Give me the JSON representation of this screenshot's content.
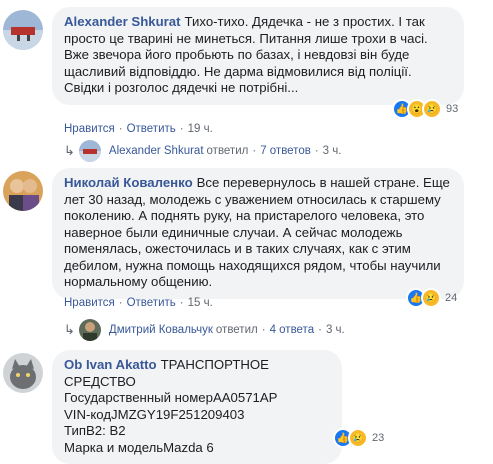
{
  "comments": [
    {
      "author": "Alexander Shkurat",
      "text": "Тихо-тихо. Дядечка - не з простих. І так просто це тварині не минеться. Питання лише трохи в часі. Вже звечора його пробьють по базах, і невдовзі він буде щасливий відповіддю. Не дарма відмовилися від поліції. Свідки і розголос дядечкі не потрібні...",
      "like_label": "Нравится",
      "reply_label": "Ответить",
      "time": "19 ч.",
      "reaction_count": "93",
      "reactions": [
        "like-icon",
        "wow-icon",
        "sad-icon"
      ],
      "replies": {
        "author": "Alexander Shkurat",
        "replied": "ответил",
        "count": "7 ответов",
        "time": "3 ч."
      }
    },
    {
      "author": "Николай Коваленко",
      "text": "Все перевернулось в нашей стране. Еще лет 30 назад, молодежь с уважением относилась к старшему поколению. А поднять руку, на пристарелого человека, это наверное были единичные случаи. А сейчас молодежь поменялась, ожесточилась и в таких случаях, как с этим дебилом, нужна помощь находящихся рядом, чтобы научили нормальному общению.",
      "like_label": "Нравится",
      "reply_label": "Ответить",
      "time": "15 ч.",
      "reaction_count": "24",
      "reactions": [
        "like-icon",
        "sad-icon"
      ],
      "replies": {
        "author": "Дмитрий Ковальчук",
        "replied": "ответил",
        "count": "4 ответа",
        "time": "3 ч."
      }
    },
    {
      "author": "Ob Ivan Akatto",
      "text_lines": [
        "ТРАНСПОРТНОЕ СРЕДСТВО",
        "Государственный номерАА0571АР",
        "VIN-кодJMZGY19F251209403",
        "ТипВ2: B2",
        "Марка и модельMazda 6"
      ],
      "reaction_count": "23",
      "reactions": [
        "like-icon",
        "sad-icon"
      ]
    }
  ]
}
